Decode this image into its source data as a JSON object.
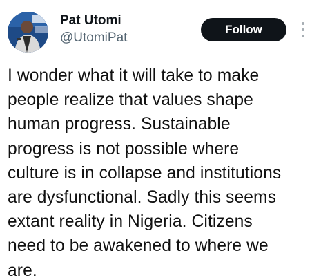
{
  "author": {
    "display_name": "Pat Utomi",
    "handle": "@UtomiPat",
    "avatar_icon": "profile-photo"
  },
  "actions": {
    "follow_label": "Follow",
    "more_icon": "vertical-dots-icon"
  },
  "tweet": {
    "text": "I wonder what it will take to make\npeople realize that values shape\nhuman progress. Sustainable\nprogress is not possible where\nculture is in collapse and institutions\nare dysfunctional. Sadly this seems\nextant reality in Nigeria. Citizens\nneed to be awakened to where we\nare."
  },
  "colors": {
    "follow_bg": "#0f1419",
    "follow_text": "#ffffff",
    "handle": "#536471",
    "avatar_bg": "#1e4a86"
  }
}
